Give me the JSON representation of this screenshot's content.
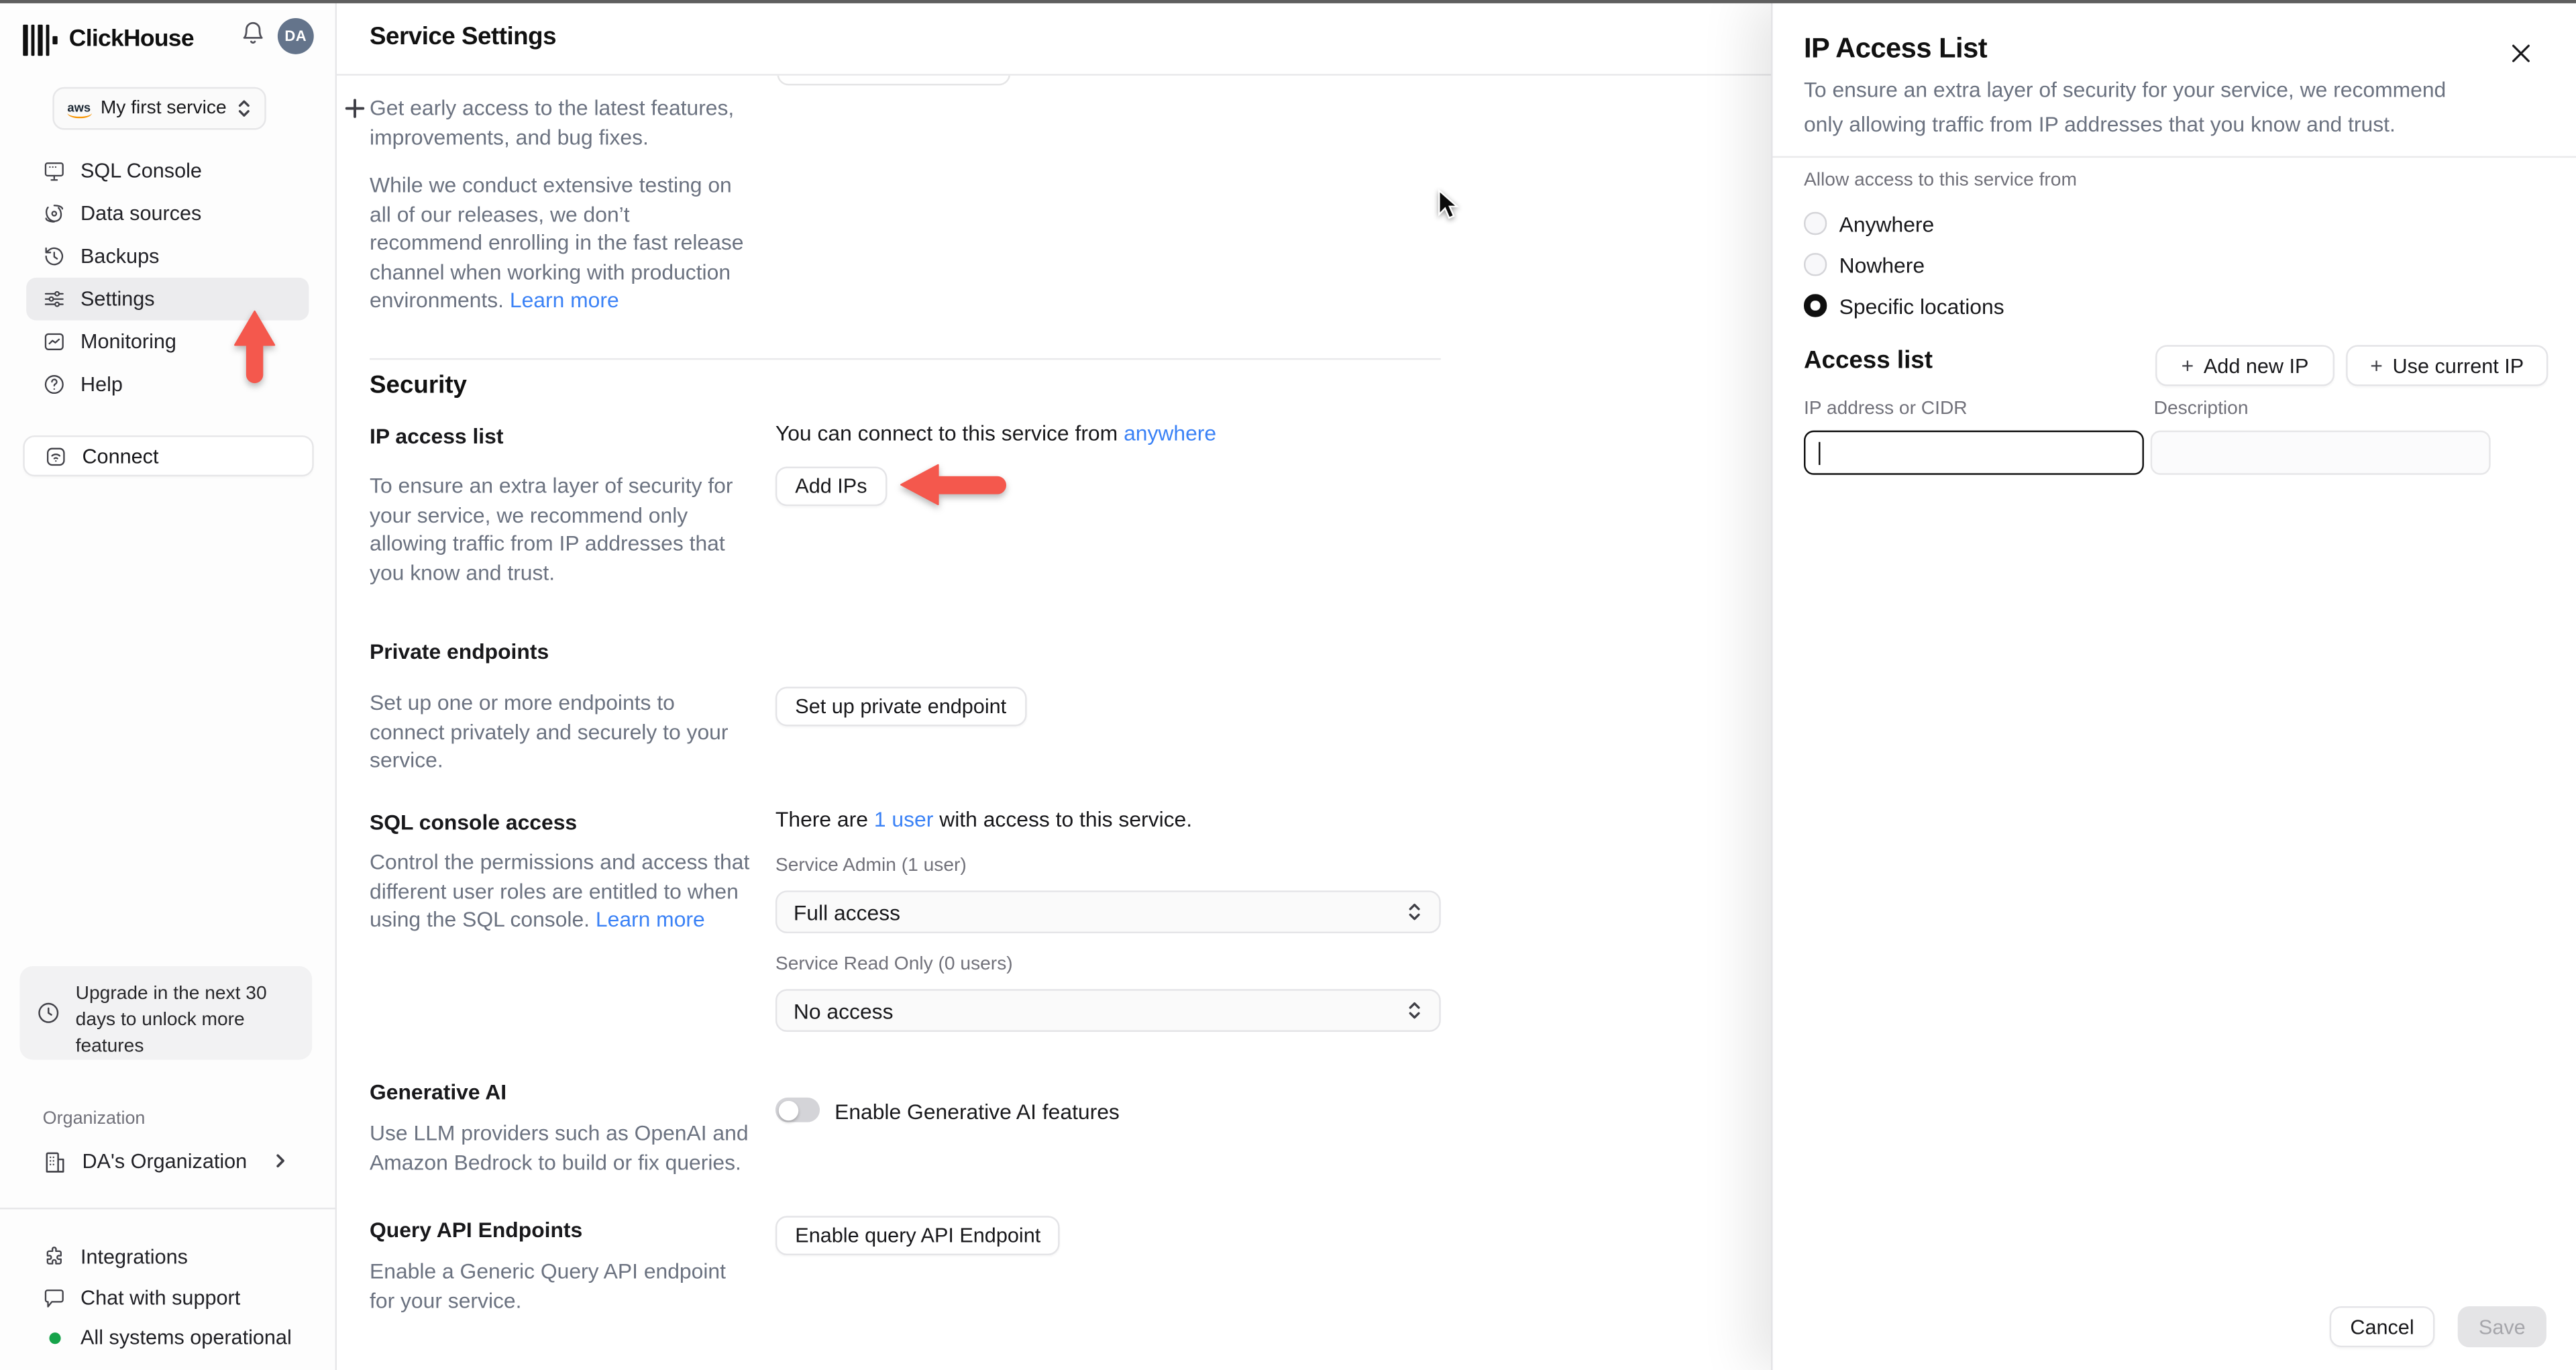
{
  "colors": {
    "accent_blue": "#3b82f6",
    "arrow_red": "#f4584d",
    "status_green": "#16a34a",
    "avatar_bg": "#64748b",
    "active_nav_bg": "#ececee"
  },
  "sidebar": {
    "brand": "ClickHouse",
    "bell_icon": "bell",
    "avatar_initials": "DA",
    "service_selector": {
      "provider_icon": "aws-logo",
      "label": "My first service"
    },
    "add_service_label": "+",
    "nav": [
      {
        "icon": "sql-console",
        "label": "SQL Console",
        "active": false
      },
      {
        "icon": "data-sources",
        "label": "Data sources",
        "active": false
      },
      {
        "icon": "backups",
        "label": "Backups",
        "active": false
      },
      {
        "icon": "settings-sliders",
        "label": "Settings",
        "active": true
      },
      {
        "icon": "monitoring-chart",
        "label": "Monitoring",
        "active": false
      },
      {
        "icon": "help-circle",
        "label": "Help",
        "active": false
      }
    ],
    "connect_label": "Connect",
    "upgrade_notice": "Upgrade in the next 30 days to unlock more features",
    "organization_section_label": "Organization",
    "organization_name": "DA's Organization",
    "footer": [
      {
        "icon": "puzzle",
        "label": "Integrations"
      },
      {
        "icon": "chat-bubble",
        "label": "Chat with support"
      },
      {
        "icon": "green-dot",
        "label": "All systems operational"
      }
    ]
  },
  "header": {
    "title": "Service Settings"
  },
  "main": {
    "release_channel": {
      "paragraph1": "Get early access to the latest features, improvements, and bug fixes.",
      "paragraph2": "While we conduct extensive testing on all of our releases, we don’t recommend enrolling in the fast release channel when working with production environments.",
      "learn_more": "Learn more"
    },
    "security": {
      "heading": "Security",
      "ip_access_list": {
        "title": "IP access list",
        "description": "To ensure an extra layer of security for your service, we recommend only allowing traffic from IP addresses that you know and trust.",
        "status_prefix": "You can connect to this service from",
        "status_link": "anywhere",
        "button": "Add IPs"
      },
      "private_endpoints": {
        "title": "Private endpoints",
        "description": "Set up one or more endpoints to connect privately and securely to your service.",
        "button": "Set up private endpoint"
      },
      "sql_console_access": {
        "title": "SQL console access",
        "description": "Control the permissions and access that different user roles are entitled to when using the SQL console.",
        "learn_more": "Learn more",
        "status_prefix": "There are",
        "status_link": "1 user",
        "status_suffix": "with access to this service.",
        "admin_label": "Service Admin (1 user)",
        "admin_value": "Full access",
        "readonly_label": "Service Read Only (0 users)",
        "readonly_value": "No access"
      },
      "generative_ai": {
        "title": "Generative AI",
        "description": "Use LLM providers such as OpenAI and Amazon Bedrock to build or fix queries.",
        "toggle_label": "Enable Generative AI features",
        "toggle_on": false
      },
      "query_api": {
        "title": "Query API Endpoints",
        "description": "Enable a Generic Query API endpoint for your service.",
        "button": "Enable query API Endpoint"
      }
    }
  },
  "panel": {
    "title": "IP Access List",
    "close_icon": "close-x",
    "description": "To ensure an extra layer of security for your service, we recommend only allowing traffic from IP addresses that you know and trust.",
    "allow_label": "Allow access to this service from",
    "options": [
      {
        "label": "Anywhere",
        "selected": false
      },
      {
        "label": "Nowhere",
        "selected": false
      },
      {
        "label": "Specific locations",
        "selected": true
      }
    ],
    "access_list": {
      "heading": "Access list",
      "add_new_ip": "Add new IP",
      "use_current_ip": "Use current IP",
      "ip_label": "IP address or CIDR",
      "ip_value": "",
      "desc_label": "Description",
      "desc_value": ""
    },
    "footer": {
      "cancel": "Cancel",
      "save": "Save"
    }
  }
}
